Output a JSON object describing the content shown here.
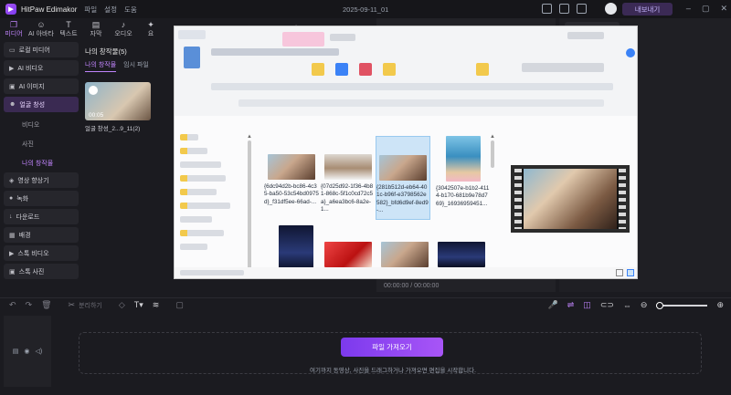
{
  "app": {
    "name": "HitPaw Edimakor",
    "menu": [
      "파일",
      "설정",
      "도움"
    ],
    "project_title": "2025-09-11_01",
    "upgrade_label": "내보내기"
  },
  "toolbar": {
    "tools": [
      {
        "label": "미디어",
        "icon": "media-icon",
        "glyph": "❐",
        "active": true
      },
      {
        "label": "AI 아바타",
        "icon": "avatar-icon",
        "glyph": "☺",
        "active": false
      },
      {
        "label": "텍스트",
        "icon": "text-icon",
        "glyph": "T",
        "active": false
      },
      {
        "label": "자막",
        "icon": "subtitle-icon",
        "glyph": "▤",
        "active": false
      },
      {
        "label": "오디오",
        "icon": "audio-icon",
        "glyph": "♪",
        "active": false
      },
      {
        "label": "요",
        "icon": "effects-icon",
        "glyph": "✦",
        "active": false
      }
    ]
  },
  "sidebar": {
    "items": [
      {
        "label": "로컬 미디어",
        "icon": "folder-icon",
        "glyph": "▭"
      },
      {
        "label": "AI 비디오",
        "icon": "ai-video-icon",
        "glyph": "▶"
      },
      {
        "label": "AI 이미지",
        "icon": "ai-image-icon",
        "glyph": "▣"
      },
      {
        "label": "얼굴 창성",
        "icon": "face-icon",
        "glyph": "☻",
        "active": true
      }
    ],
    "sub_items": [
      {
        "label": "비디오"
      },
      {
        "label": "사진"
      },
      {
        "label": "나의 창작물",
        "active": true
      }
    ],
    "items_bottom": [
      {
        "label": "영상 향상기",
        "icon": "enhance-icon",
        "glyph": "◈"
      },
      {
        "label": "녹화",
        "icon": "record-icon",
        "glyph": "●"
      },
      {
        "label": "다운로드",
        "icon": "download-icon",
        "glyph": "↓"
      },
      {
        "label": "배경",
        "icon": "background-icon",
        "glyph": "▦"
      },
      {
        "label": "스톡 비디오",
        "icon": "stock-video-icon",
        "glyph": "▶"
      },
      {
        "label": "스톡 사진",
        "icon": "stock-photo-icon",
        "glyph": "▣"
      }
    ]
  },
  "media_panel": {
    "title": "나의 창작물(5)",
    "tabs": [
      {
        "label": "나의 창작물",
        "active": true
      },
      {
        "label": "임시 파일",
        "active": false
      }
    ],
    "thumb_duration": "00:05",
    "thumb_label": "얼굴 창성_2...9_11(2)"
  },
  "file_dialog": {
    "files": [
      {
        "name": "{6dc94d2b-bc86-4c35-ba50-53c54bd0975d}_f31df5ee-66ad-...",
        "kind": "couple",
        "selected": false
      },
      {
        "name": "{07d25d92-1f36-4b81-868c-5f1c0cd72c5a}_a6ea3bc6-8a2e-1...",
        "kind": "boy",
        "selected": false
      },
      {
        "name": "{281b512d-eb64-401c-b96f-e3798562e582}_bfd6d9ef-8ed9-...",
        "kind": "couple",
        "selected": true
      },
      {
        "name": "{3042507e-b1b2-4114-b170-681b9e78d769}_16936959451...",
        "kind": "beach",
        "selected": false
      }
    ]
  },
  "preview": {
    "timecode": "00:00:00 / 00:00:00"
  },
  "timeline": {
    "split_label": "분리하기",
    "import_label": "파일 가져오기",
    "drop_hint": "여기까지 동영상, 사진을 드래그하거나 가져오면 편집을 시작합니다."
  },
  "colors": {
    "accent": "#a855f7",
    "background": "#1b1b20"
  }
}
